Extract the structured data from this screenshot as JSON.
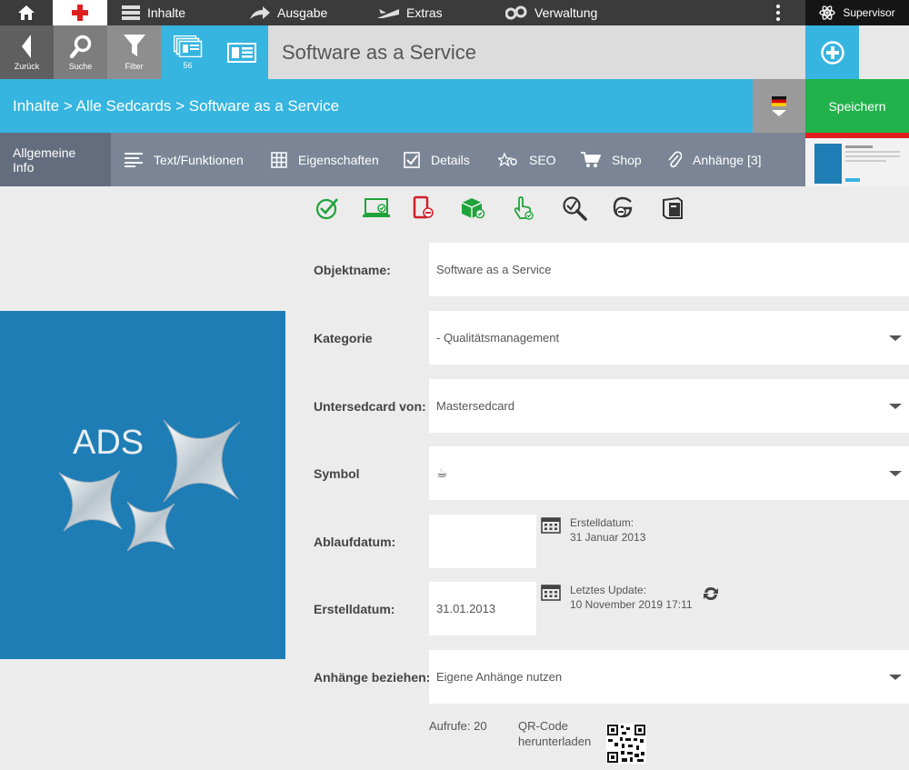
{
  "topbar": {
    "home_icon": "home-icon",
    "plus_icon": "red-cross-icon",
    "menu": [
      {
        "label": "Inhalte",
        "icon": "list-icon"
      },
      {
        "label": "Ausgabe",
        "icon": "share-arrow-icon"
      },
      {
        "label": "Extras",
        "icon": "plane-icon"
      },
      {
        "label": "Verwaltung",
        "icon": "gears-icon"
      }
    ],
    "supervisor_label": "Supervisor"
  },
  "toolbar": {
    "back_label": "Zurück",
    "search_label": "Suche",
    "filter_label": "Filter",
    "count_label": "56",
    "title": "Software as a Service"
  },
  "breadcrumb": "Inhalte > Alle Sedcards > Software as a Service",
  "save_label": "Speichern",
  "tabs": [
    {
      "label": "Allgemeine Info"
    },
    {
      "label": "Text/Funktionen"
    },
    {
      "label": "Eigenschaften"
    },
    {
      "label": "Details"
    },
    {
      "label": "SEO"
    },
    {
      "label": "Shop"
    },
    {
      "label": "Anhänge [3]"
    }
  ],
  "image": {
    "text": "ADS"
  },
  "form": {
    "objektname": {
      "label": "Objektname:",
      "value": "Software as a Service"
    },
    "kategorie": {
      "label": "Kategorie",
      "value": "- Qualitätsmanagement"
    },
    "untersedcard": {
      "label": "Untersedcard von:",
      "value": "Mastersedcard"
    },
    "symbol": {
      "label": "Symbol",
      "value": "☕"
    },
    "ablaufdatum": {
      "label": "Ablaufdatum:",
      "value": ""
    },
    "erstelldatum": {
      "label": "Erstelldatum:",
      "value": "31.01.2013"
    },
    "anhaenge": {
      "label": "Anhänge beziehen:",
      "value": "Eigene Anhänge nutzen"
    }
  },
  "meta": {
    "created_label": "Erstelldatum:",
    "created_value": "31 Januar 2013",
    "updated_label": "Letztes Update:",
    "updated_value": "10 November 2019 17:11"
  },
  "footer": {
    "aufrufe": "Aufrufe: 20",
    "qr_line1": "QR-Code",
    "qr_line2": "herunterladen"
  },
  "colors": {
    "accent": "#36b5e0",
    "save": "#21b24b",
    "tabs": "#7b8596",
    "image": "#1e7db4"
  }
}
